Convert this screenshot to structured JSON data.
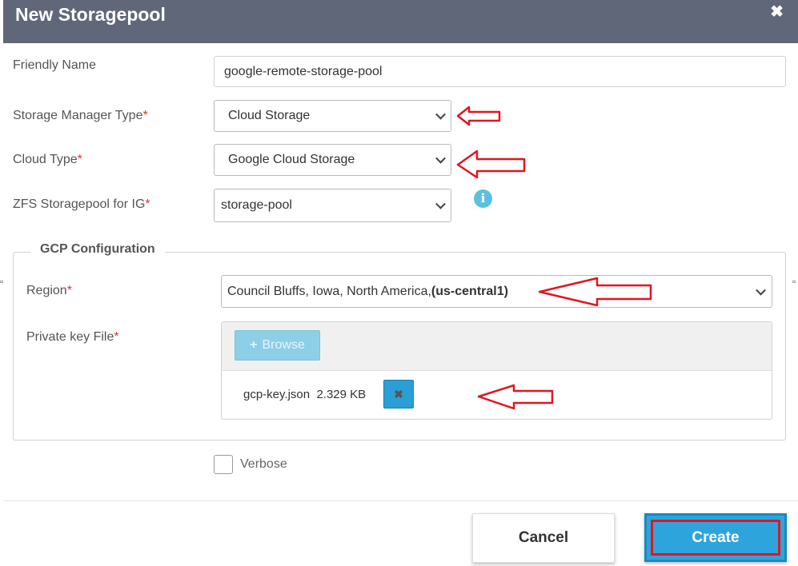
{
  "dialog": {
    "title": "New Storagepool",
    "close_icon": "close-icon"
  },
  "fields": {
    "friendly_name": {
      "label": "Friendly Name",
      "value": "google-remote-storage-pool"
    },
    "storage_manager_type": {
      "label": "Storage Manager Type",
      "required": "*",
      "value": "Cloud Storage"
    },
    "cloud_type": {
      "label": "Cloud Type",
      "required": "*",
      "value": "Google Cloud Storage"
    },
    "zfs_storagepool": {
      "label": "ZFS Storagepool for IG",
      "required": "*",
      "value": "storage-pool",
      "info_icon": "i"
    }
  },
  "gcp": {
    "legend": "GCP Configuration",
    "region": {
      "label": "Region",
      "required": "*",
      "value_prefix": "Council Bluffs, Iowa, North America,",
      "value_code": "(us-central1)"
    },
    "private_key": {
      "label": "Private key File",
      "required": "*",
      "browse_label": "Browse",
      "browse_icon": "+",
      "file_name": "gcp-key.json",
      "file_size": "2.329 KB",
      "remove_icon": "✖"
    }
  },
  "verbose": {
    "label": "Verbose",
    "checked": false
  },
  "footer": {
    "cancel_label": "Cancel",
    "create_label": "Create"
  },
  "colors": {
    "header": "#5f6779",
    "accent": "#2da5dc",
    "annotation": "#e0161f",
    "required": "#d9333f"
  }
}
